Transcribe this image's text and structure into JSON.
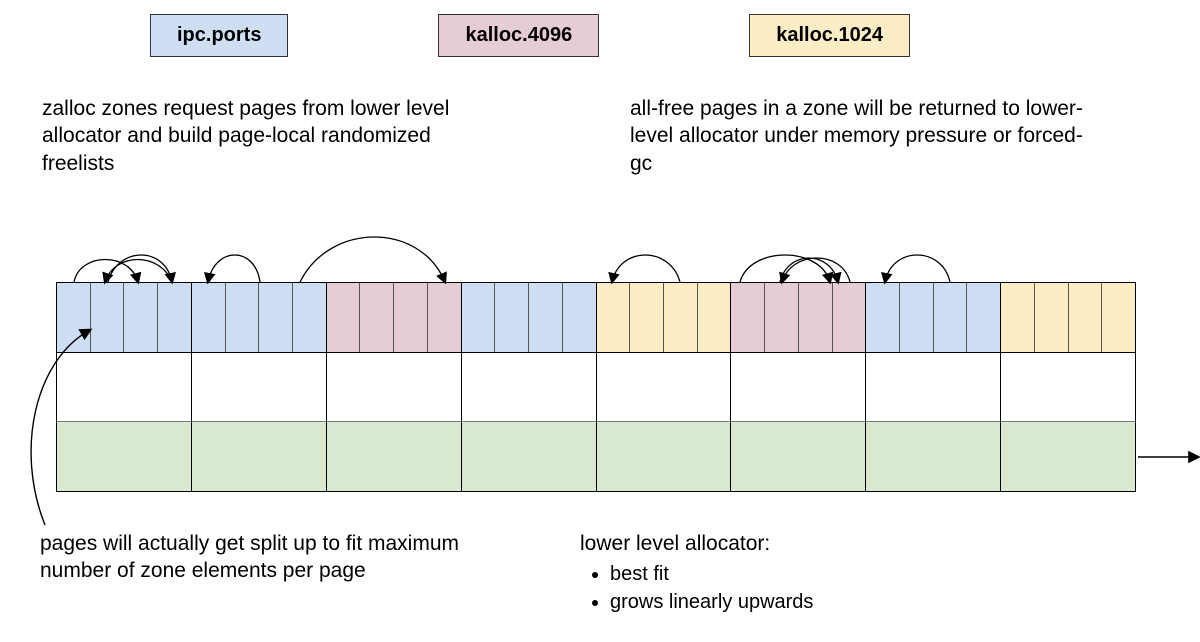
{
  "legend": {
    "items": [
      {
        "label": "ipc.ports",
        "color": "#cedff4"
      },
      {
        "label": "kalloc.4096",
        "color": "#e6ccd6"
      },
      {
        "label": "kalloc.1024",
        "color": "#fdedc5"
      }
    ]
  },
  "narration": {
    "top_left": "zalloc zones request pages from lower level allocator and build page-local randomized freelists",
    "top_right": "all-free pages in a zone will be returned to lower-level allocator under memory pressure or forced-gc",
    "bottom_left": "pages will actually get split up to fit maximum number of zone elements per page",
    "bottom_right_heading": "lower level allocator:",
    "bottom_right_bullets": [
      "best fit",
      "grows linearly upwards"
    ]
  },
  "colors": {
    "ipc_ports": "#cedff4",
    "kalloc_4096": "#e6ccd6",
    "kalloc_1024": "#fdedc5",
    "lower_alloc": "#d8e8d1"
  },
  "pages": [
    {
      "zone": "ipc.ports",
      "slot_color": "c-blue",
      "slots": 4
    },
    {
      "zone": "ipc.ports",
      "slot_color": "c-blue",
      "slots": 4
    },
    {
      "zone": "kalloc.4096",
      "slot_color": "c-pink",
      "slots": 4
    },
    {
      "zone": "ipc.ports",
      "slot_color": "c-blue",
      "slots": 4
    },
    {
      "zone": "kalloc.1024",
      "slot_color": "c-tan",
      "slots": 4
    },
    {
      "zone": "kalloc.4096",
      "slot_color": "c-pink",
      "slots": 4
    },
    {
      "zone": "ipc.ports",
      "slot_color": "c-blue",
      "slots": 4
    },
    {
      "zone": "kalloc.1024",
      "slot_color": "c-tan",
      "slots": 4
    }
  ],
  "freelist_arcs_note": "curved arrows above slot rows depict randomized intra-page freelists",
  "side_arrow_note": "right-pointing arrow from green base indicates linear upward growth"
}
